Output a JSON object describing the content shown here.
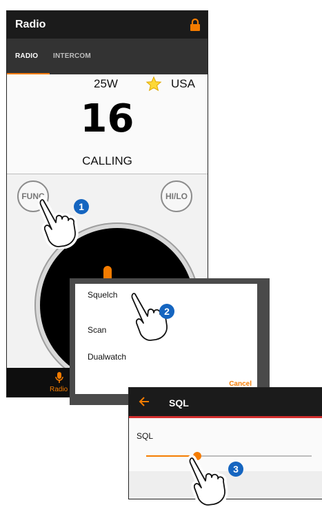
{
  "main_screen": {
    "title": "Radio",
    "tabs": [
      {
        "label": "RADIO",
        "active": true
      },
      {
        "label": "INTERCOM",
        "active": false
      }
    ],
    "power": "25W",
    "favorite_icon": "star-icon",
    "region": "USA",
    "channel": "16",
    "channel_name": "CALLING",
    "func_label": "FUNC",
    "hilo_label": "HI/LO",
    "nav_radio_label": "Radio"
  },
  "dialog": {
    "options": [
      "Squelch",
      "Scan",
      "Dualwatch"
    ],
    "cancel_label": "Cancel"
  },
  "sql_screen": {
    "title": "SQL",
    "label": "SQL",
    "level_fraction": 0.31
  },
  "callouts": [
    "1",
    "2",
    "3"
  ],
  "colors": {
    "accent": "#f57c00",
    "callout": "#1565c0",
    "bar": "#1b1b1b",
    "tab_bar": "#333333"
  }
}
